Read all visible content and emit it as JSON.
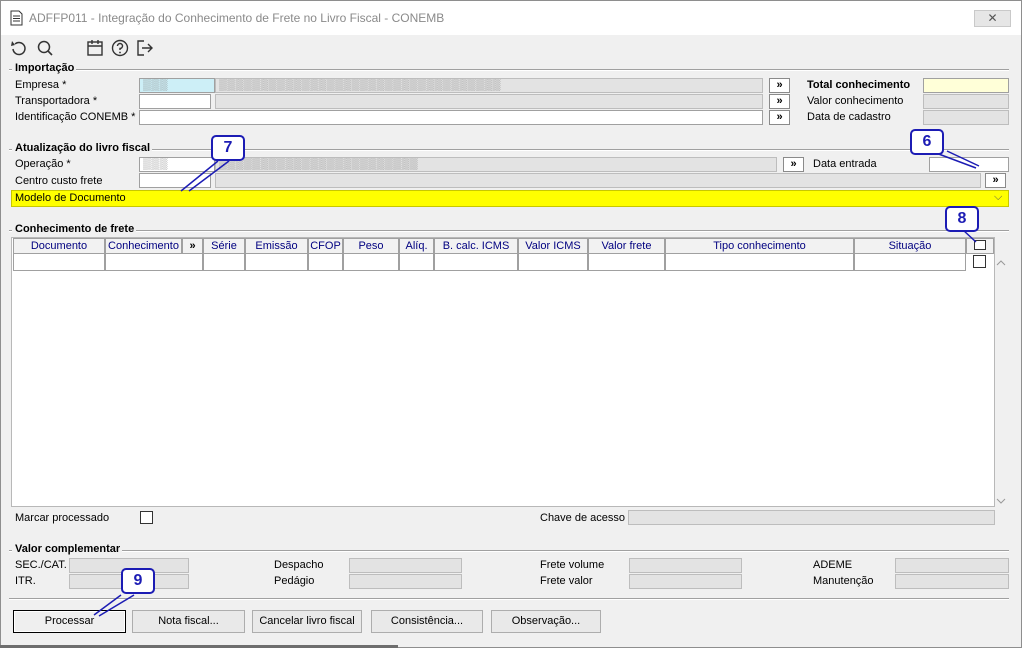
{
  "window": {
    "title": "ADFFP011 - Integração do Conhecimento de Frete no Livro Fiscal - CONEMB",
    "close_label": "✕"
  },
  "importacao": {
    "title": "Importação",
    "empresa_label": "Empresa *",
    "empresa_code": "▒▒▒",
    "empresa_name": "▒▒▒▒▒▒▒▒▒▒▒▒▒▒▒▒▒▒▒▒▒▒▒▒▒▒▒▒▒▒▒▒▒▒",
    "transportadora_label": "Transportadora *",
    "identificacao_label": "Identificação CONEMB *",
    "total_label": "Total conhecimento",
    "valor_label": "Valor conhecimento",
    "data_cadastro_label": "Data de cadastro",
    "search_glyph": "»"
  },
  "atualizacao": {
    "title": "Atualização do livro fiscal",
    "operacao_label": "Operação *",
    "operacao_code": "▒▒▒",
    "operacao_name": "▒▒▒▒▒▒▒▒▒▒▒▒▒▒▒▒▒▒▒▒▒▒▒▒",
    "centro_label": "Centro custo frete",
    "modelo_label": "Modelo de Documento",
    "data_entrada_label": "Data entrada",
    "dropdown_glyph": "⌵"
  },
  "conhecimento": {
    "title": "Conhecimento de frete",
    "columns": [
      "Documento",
      "Conhecimento",
      "»",
      "Série",
      "Emissão",
      "CFOP",
      "Peso",
      "Alíq.",
      "B. calc. ICMS",
      "Valor ICMS",
      "Valor frete",
      "Tipo conhecimento",
      "Situação"
    ],
    "marcar_label": "Marcar processado",
    "chave_label": "Chave de acesso"
  },
  "valor_complementar": {
    "title": "Valor complementar",
    "sec_cat_label": "SEC./CAT.",
    "itr_label": "ITR.",
    "despacho_label": "Despacho",
    "pedagio_label": "Pedágio",
    "frete_volume_label": "Frete volume",
    "frete_valor_label": "Frete valor",
    "ademe_label": "ADEME",
    "manutencao_label": "Manutenção"
  },
  "buttons": {
    "processar": "Processar",
    "nota_fiscal": "Nota fiscal...",
    "cancelar": "Cancelar livro fiscal",
    "consistencia": "Consistência...",
    "observacao": "Observação..."
  },
  "callouts": {
    "c6": "6",
    "c7": "7",
    "c8": "8",
    "c9": "9"
  },
  "colors": {
    "highlight_yellow": "#ffff00",
    "callout_blue": "#1c1cb4",
    "header_text": "#000080"
  }
}
